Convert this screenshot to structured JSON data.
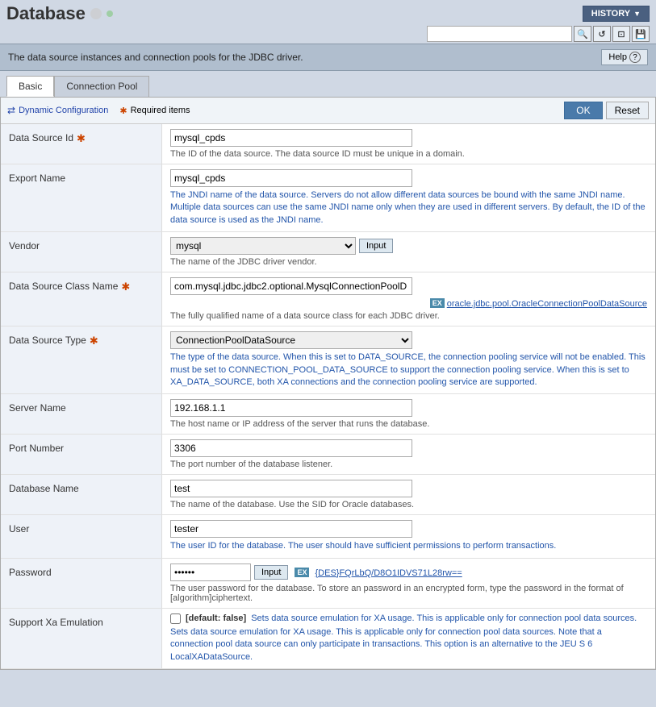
{
  "app": {
    "title": "Database",
    "history_label": "HISTORY",
    "info_text": "The data source instances and connection pools for the JDBC driver.",
    "help_label": "Help",
    "help_icon": "?"
  },
  "search": {
    "placeholder": ""
  },
  "tabs": [
    {
      "label": "Basic",
      "active": true
    },
    {
      "label": "Connection Pool",
      "active": false
    }
  ],
  "toolbar": {
    "dynamic_config_label": "Dynamic Configuration",
    "required_items_label": "Required items",
    "ok_label": "OK",
    "reset_label": "Reset"
  },
  "fields": {
    "data_source_id": {
      "label": "Data Source Id",
      "required": true,
      "value": "mysql_cpds",
      "desc": "The ID of the data source. The data source ID must be unique in a domain."
    },
    "export_name": {
      "label": "Export Name",
      "required": false,
      "value": "mysql_cpds",
      "desc": "The JNDI name of the data source. Servers do not allow different data sources be bound with the same JNDI name. Multiple data sources can use the same JNDI name only when they are used in different servers. By default, the ID of the data source is used as the JNDI name."
    },
    "vendor": {
      "label": "Vendor",
      "required": false,
      "value": "mysql",
      "input_label": "Input",
      "desc": "The name of the JDBC driver vendor."
    },
    "data_source_class_name": {
      "label": "Data Source Class Name",
      "required": true,
      "value": "com.mysql.jdbc.jdbc2.optional.MysqlConnectionPoolD",
      "ex_label": "oracle.jdbc.pool.OracleConnectionPoolDataSource",
      "desc": "The fully qualified name of a data source class for each JDBC driver."
    },
    "data_source_type": {
      "label": "Data Source Type",
      "required": true,
      "value": "ConnectionPoolDataSource",
      "desc": "The type of the data source. When this is set to DATA_SOURCE, the connection pooling service will not be enabled. This must be set to CONNECTION_POOL_DATA_SOURCE to support the connection pooling service. When this is set to XA_DATA_SOURCE, both XA connections and the connection pooling service are supported."
    },
    "server_name": {
      "label": "Server Name",
      "required": false,
      "value": "192.168.1.1",
      "desc": "The host name or IP address of the server that runs the database."
    },
    "port_number": {
      "label": "Port Number",
      "required": false,
      "value": "3306",
      "desc": "The port number of the database listener."
    },
    "database_name": {
      "label": "Database Name",
      "required": false,
      "value": "test",
      "desc": "The name of the database. Use the SID for Oracle databases."
    },
    "user": {
      "label": "User",
      "required": false,
      "value": "tester",
      "desc": "The user ID for the database. The user should have sufficient permissions to perform transactions."
    },
    "password": {
      "label": "Password",
      "required": false,
      "value": "••••••",
      "input_label": "Input",
      "ex_label": "{DES}FQrLbQ/D8O1IDVS71L28rw==",
      "desc": "The user password for the database. To store an password in an encrypted form, type the password in the format of [algorithm]ciphertext."
    },
    "support_xa": {
      "label": "Support Xa Emulation",
      "required": false,
      "default_label": "[default: false]",
      "desc1": "Sets data source emulation for XA usage. This is applicable only for connection pool data sources. Note that a connection pool data source can only participate in transactions. This option is an alternative to the JEU S 6 LocalXADataSource."
    }
  }
}
